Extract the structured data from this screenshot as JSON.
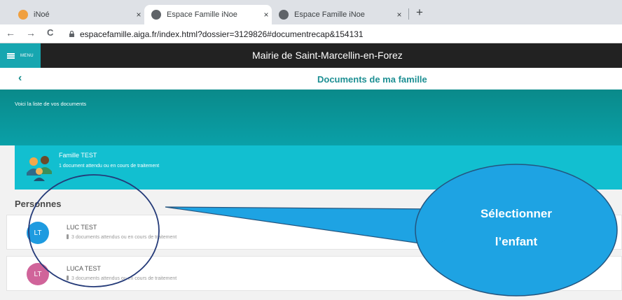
{
  "browser": {
    "tabs": [
      {
        "title": "iNoé",
        "close": "×"
      },
      {
        "title": "Espace Famille iNoe",
        "close": "×"
      },
      {
        "title": "Espace Famille iNoe",
        "close": "×"
      }
    ],
    "new_tab": "+",
    "nav": {
      "back": "←",
      "forward": "→",
      "reload": "C"
    },
    "url": "espacefamille.aiga.fr/index.html?dossier=3129826#documentrecap&154131"
  },
  "app": {
    "menu_label": "MENU",
    "title": "Mairie de Saint-Marcellin-en-Forez"
  },
  "subheader": {
    "back": "‹",
    "title": "Documents de ma famille"
  },
  "banner": {
    "intro": "Voici la liste de vos documents"
  },
  "family": {
    "name": "Famille TEST",
    "status": "1 document attendu ou en cours de traitement"
  },
  "persons": {
    "heading": "Personnes",
    "items": [
      {
        "initials": "LT",
        "name": "LUC TEST",
        "status": "3 documents attendus ou en cours de traitement",
        "color": "#1e9be0"
      },
      {
        "initials": "LT",
        "name": "LUCA TEST",
        "status": "3 documents attendus ou en cours de traitement",
        "color": "#d0649a"
      }
    ]
  },
  "annotation": {
    "line1": "Sélectionner",
    "line2": "l’enfant",
    "callout_color": "#1ea3e3"
  }
}
